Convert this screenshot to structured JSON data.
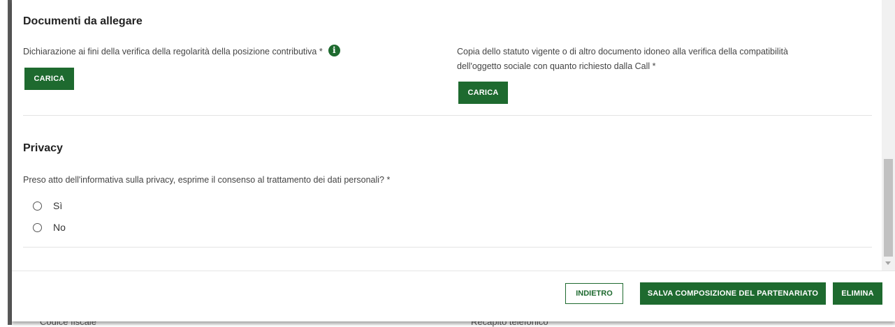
{
  "background_fields": {
    "left": "Codice fiscale",
    "right": "Recapito telefonico"
  },
  "documents": {
    "title": "Documenti da allegare",
    "doc1": {
      "label": "Dichiarazione ai fini della verifica della regolarità della posizione contributiva *",
      "info_icon": "info-icon",
      "button": "CARICA"
    },
    "doc2": {
      "label_line1": "Copia dello statuto vigente o di altro documento idoneo alla verifica della compatibilità",
      "label_line2": "dell'oggetto sociale con quanto richiesto dalla Call *",
      "button": "CARICA"
    }
  },
  "privacy": {
    "title": "Privacy",
    "question": "Preso atto dell'informativa sulla privacy, esprime il consenso al trattamento dei dati personali? *",
    "options": [
      {
        "label": "Sì",
        "selected": false
      },
      {
        "label": "No",
        "selected": false
      }
    ]
  },
  "footer": {
    "back_label": "INDIETRO",
    "save_label": "SALVA COMPOSIZIONE DEL PARTENARIATO",
    "delete_label": "ELIMINA"
  },
  "colors": {
    "primary": "#1e6a2f",
    "text": "#333333",
    "divider": "#e3e3e3"
  }
}
